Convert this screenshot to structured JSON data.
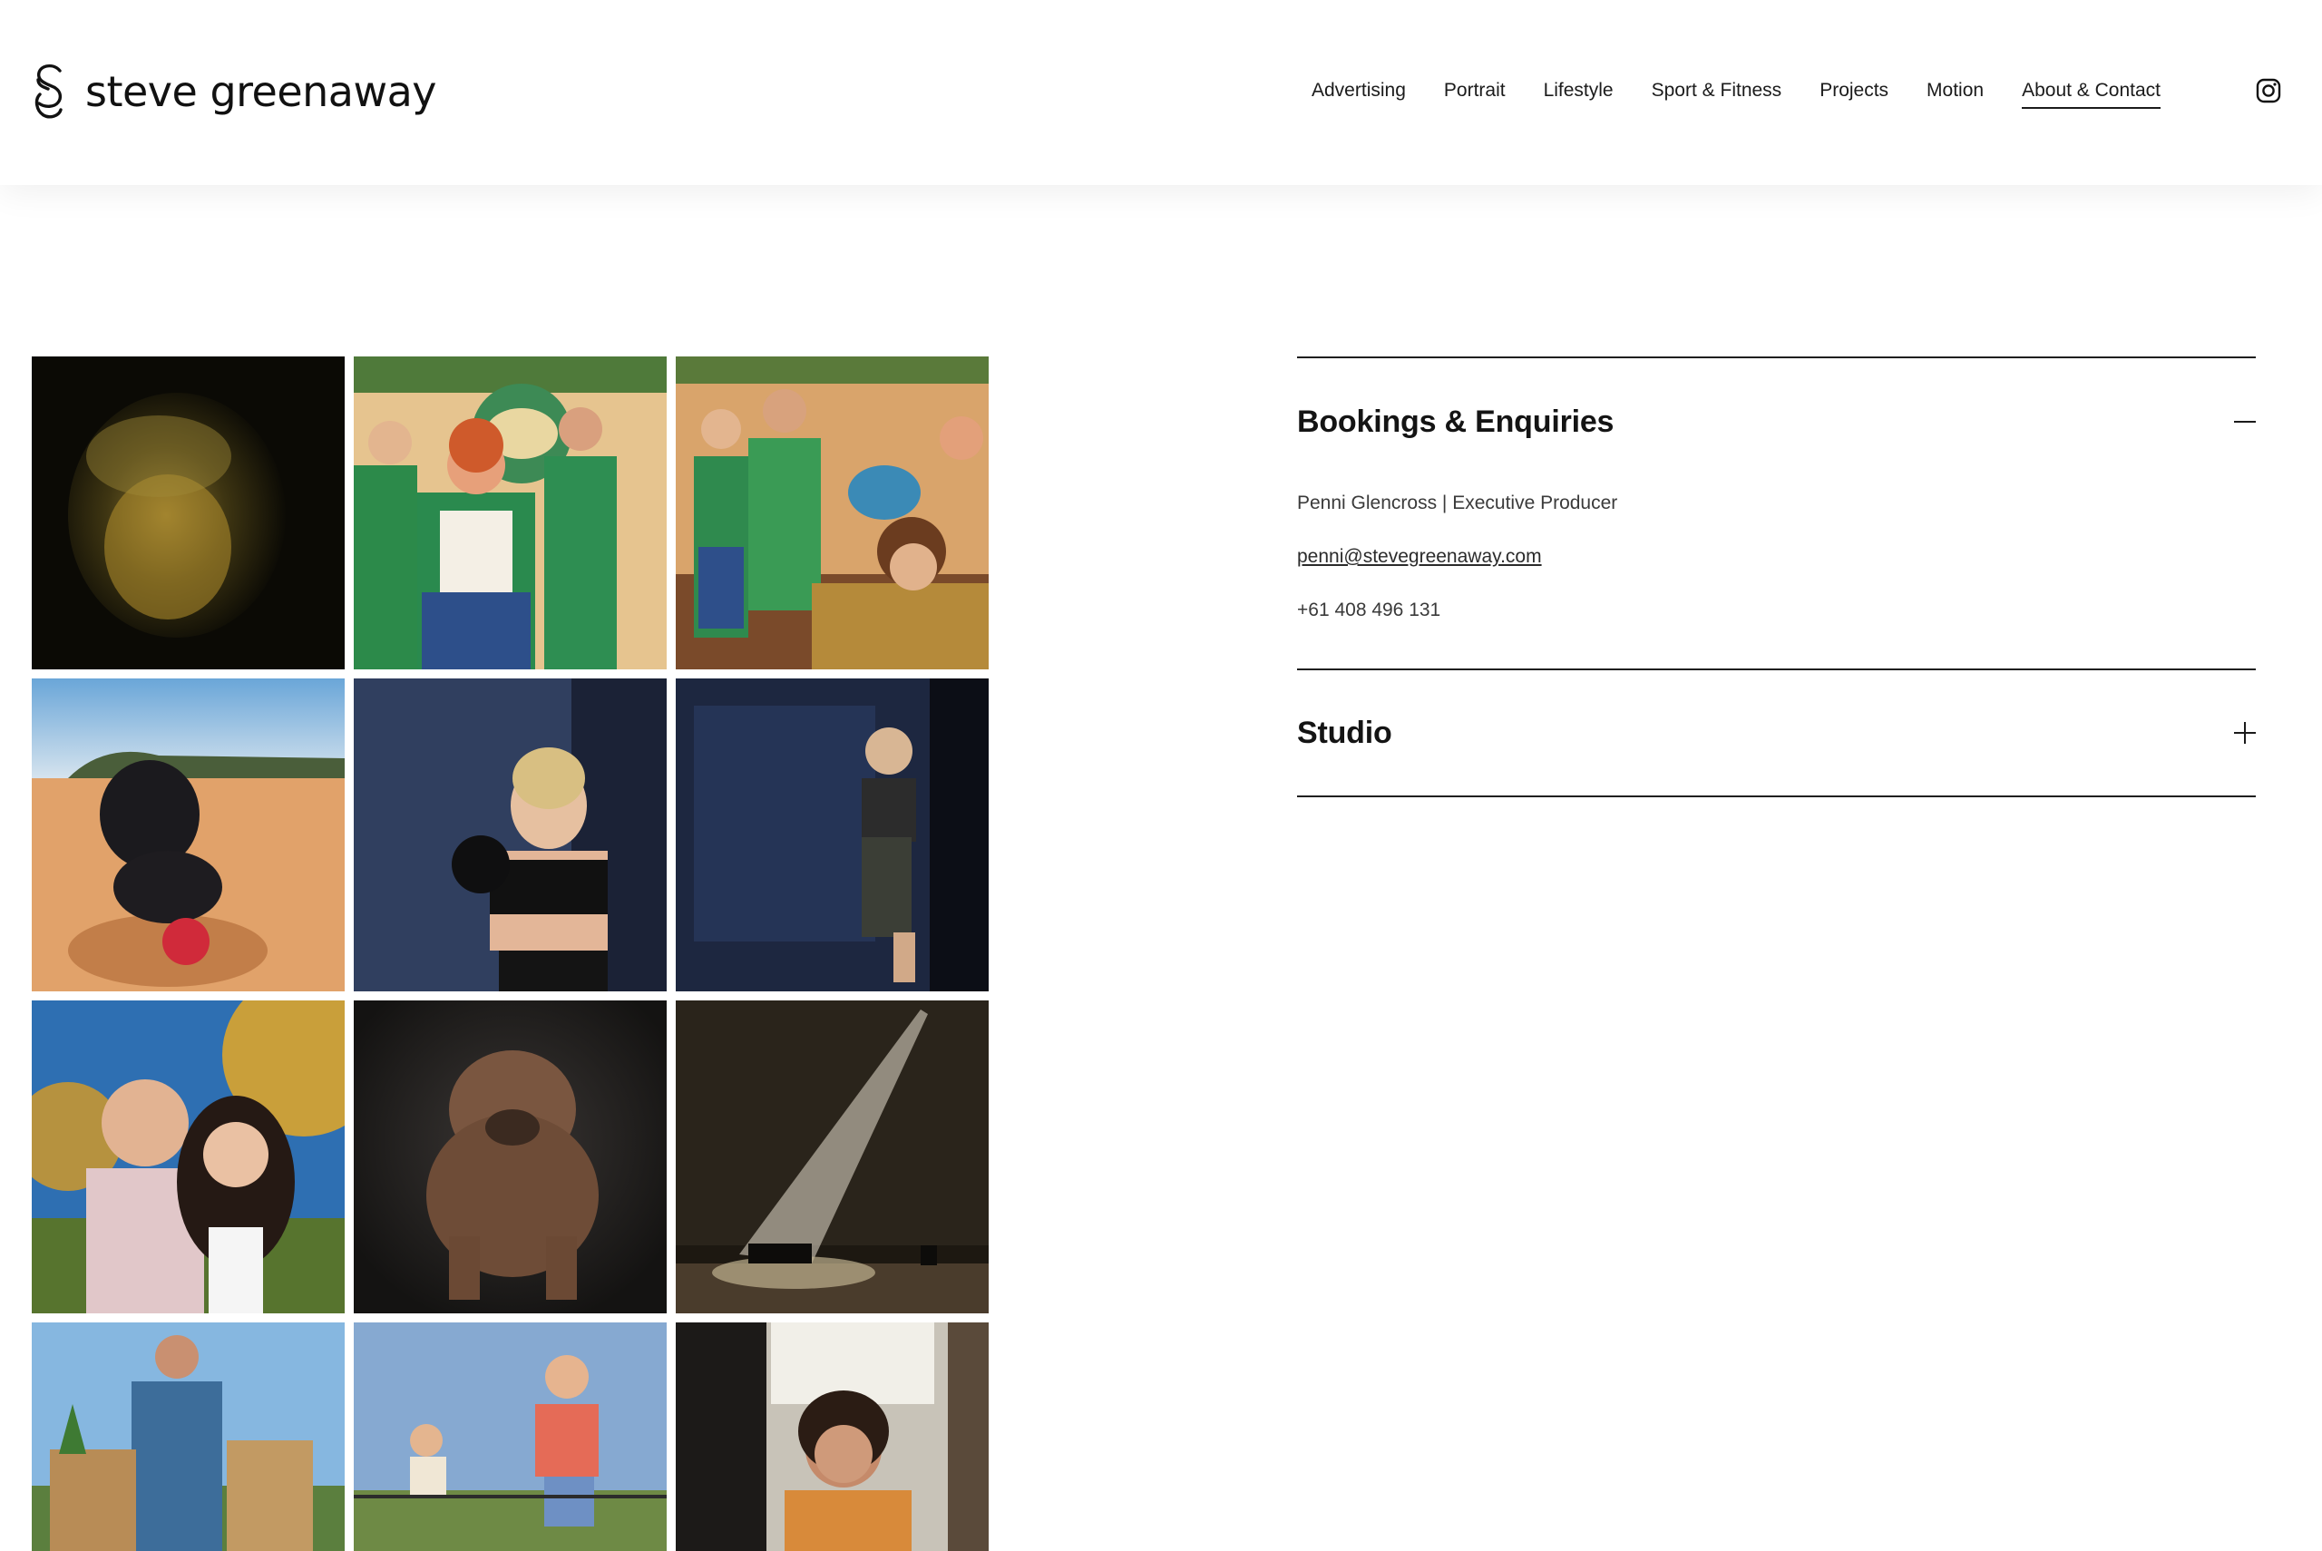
{
  "brand": {
    "name": "steve greenaway"
  },
  "nav": {
    "items": [
      {
        "label": "Advertising"
      },
      {
        "label": "Portrait"
      },
      {
        "label": "Lifestyle"
      },
      {
        "label": "Sport & Fitness"
      },
      {
        "label": "Projects"
      },
      {
        "label": "Motion"
      },
      {
        "label": "About & Contact",
        "active": true
      }
    ],
    "social_icon": "instagram-icon"
  },
  "gallery": {
    "photos": [
      {
        "subject": "baby-portrait"
      },
      {
        "subject": "group-green-aprons"
      },
      {
        "subject": "group-salon-scene"
      },
      {
        "subject": "dog-on-beach"
      },
      {
        "subject": "boxer-woman"
      },
      {
        "subject": "kickboxer-woman"
      },
      {
        "subject": "couple-selfie"
      },
      {
        "subject": "mastiff-dog"
      },
      {
        "subject": "stage-spotlight-piano"
      },
      {
        "subject": "man-grocery-bags"
      },
      {
        "subject": "trampoline-jumpers"
      },
      {
        "subject": "woman-at-fridge"
      }
    ]
  },
  "accordion": {
    "bookings": {
      "title": "Bookings & Enquiries",
      "expanded": true,
      "contact_name": "Penni Glencross | Executive Producer",
      "email": "penni@stevegreenaway.com",
      "phone": "+61 408 496 131"
    },
    "studio": {
      "title": "Studio",
      "expanded": false
    }
  },
  "colors": {
    "text": "#1a1a1a",
    "rule": "#1f1f1f",
    "background": "#ffffff"
  }
}
